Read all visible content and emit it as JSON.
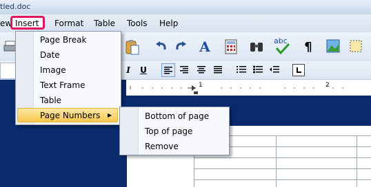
{
  "window": {
    "title_fragment": "tled.doc"
  },
  "menubar": {
    "items": [
      {
        "label": "ew"
      },
      {
        "label": "Insert"
      },
      {
        "label": "Format"
      },
      {
        "label": "Table"
      },
      {
        "label": "Tools"
      },
      {
        "label": "Help"
      }
    ]
  },
  "insert_menu": {
    "items": [
      {
        "label": "Page Break"
      },
      {
        "label": "Date"
      },
      {
        "label": "Image"
      },
      {
        "label": "Text Frame"
      },
      {
        "label": "Table"
      },
      {
        "label": "Page Numbers",
        "submenu_arrow": "▶"
      }
    ]
  },
  "page_numbers_submenu": {
    "items": [
      {
        "label": "Bottom of page"
      },
      {
        "label": "Top of page"
      },
      {
        "label": "Remove"
      }
    ]
  },
  "format_toolbar": {
    "italic_label": "I",
    "underline_label": "U"
  },
  "ruler": {
    "marks": [
      "1",
      "2"
    ]
  },
  "colors": {
    "accent_highlight": "#e1155f",
    "menu_hover": "#f8c84f",
    "workspace": "#0a2a6e"
  }
}
